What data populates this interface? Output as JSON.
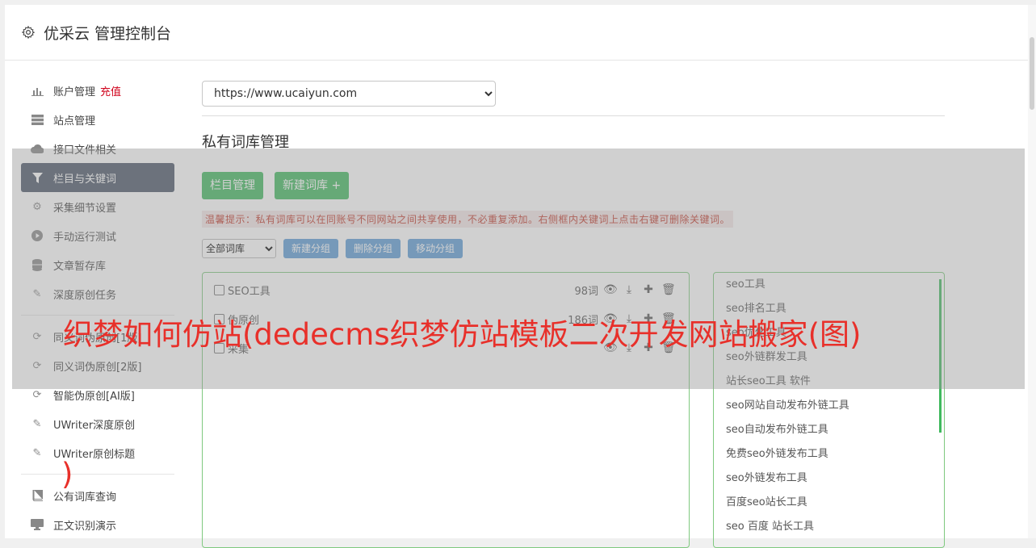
{
  "header": {
    "title": "优采云 管理控制台",
    "icon": "gear-icon"
  },
  "sidebar": {
    "items": [
      {
        "label": "账户管理",
        "badge": "充值",
        "icon": "bar-chart-icon"
      },
      {
        "label": "站点管理",
        "icon": "server-icon"
      },
      {
        "label": "接口文件相关",
        "icon": "cloud-upload-icon"
      },
      {
        "label": "栏目与关键词",
        "icon": "filter-icon",
        "active": true
      },
      {
        "label": "采集细节设置",
        "icon": "cogs-icon"
      },
      {
        "label": "手动运行测试",
        "icon": "play-icon"
      },
      {
        "label": "文章暂存库",
        "icon": "database-icon"
      },
      {
        "label": "深度原创任务",
        "icon": "edit-icon"
      },
      {
        "label": "同义词伪原创[1版]",
        "icon": "refresh-icon"
      },
      {
        "label": "同义词伪原创[2版]",
        "icon": "refresh-icon"
      },
      {
        "label": "智能伪原创[AI版]",
        "icon": "refresh-icon"
      },
      {
        "label": "UWriter深度原创",
        "icon": "edit-icon"
      },
      {
        "label": "UWriter原创标题",
        "icon": "edit-icon"
      },
      {
        "label": "公有词库查询",
        "icon": "book-icon"
      },
      {
        "label": "正文识别演示",
        "icon": "monitor-icon"
      }
    ]
  },
  "main": {
    "site_select": "https://www.ucaiyun.com",
    "section_title": "私有词库管理",
    "buttons": {
      "column_manage": "栏目管理",
      "new_library": "新建词库 +"
    },
    "tip": "温馨提示：私有词库可以在同账号不同网站之间共享使用，不必重复添加。右侧框内关键词上点击右键可删除关键词。",
    "group_filter": "全部词库",
    "group_buttons": {
      "new": "新建分组",
      "delete": "删除分组",
      "move": "移动分组"
    },
    "libraries": [
      {
        "name": "SEO工具",
        "count": "98词"
      },
      {
        "name": "伪原创",
        "count": "186词"
      },
      {
        "name": "采集",
        "count": ""
      }
    ],
    "keywords": [
      "seo工具",
      "seo排名工具",
      "seo优化工具",
      "seo外链群发工具",
      "站长seo工具 软件",
      "seo网站自动发布外链工具",
      "seo自动发布外链工具",
      "免费seo外链发布工具",
      "seo外链发布工具",
      "百度seo站长工具",
      "seo 百度 站长工具"
    ]
  },
  "overlay": {
    "headline": "织梦如何仿站(dedecms织梦仿站模板二次开发网站搬家(图)",
    "tail": ")"
  },
  "colors": {
    "accent_green": "#3fb95d",
    "accent_blue": "#5b9bd5",
    "active_nav": "#4a5566",
    "overlay_text": "#e8302a"
  }
}
